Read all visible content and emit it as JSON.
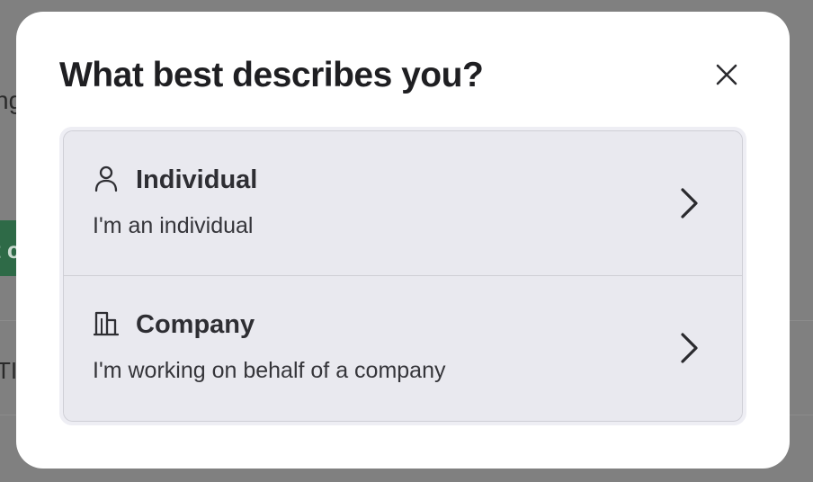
{
  "modal": {
    "title": "What best describes you?",
    "close_icon": "close-icon",
    "options": [
      {
        "icon": "person-icon",
        "title": "Individual",
        "description": "I'm an individual",
        "chevron_icon": "chevron-right-icon"
      },
      {
        "icon": "building-icon",
        "title": "Company",
        "description": "I'm working on behalf of a company",
        "chevron_icon": "chevron-right-icon"
      }
    ]
  },
  "colors": {
    "backdrop": "#808080",
    "modal_bg": "#ffffff",
    "option_bg": "#e9e9ef",
    "title_text": "#1f1f22",
    "bg_button": "#2e6a47"
  }
}
